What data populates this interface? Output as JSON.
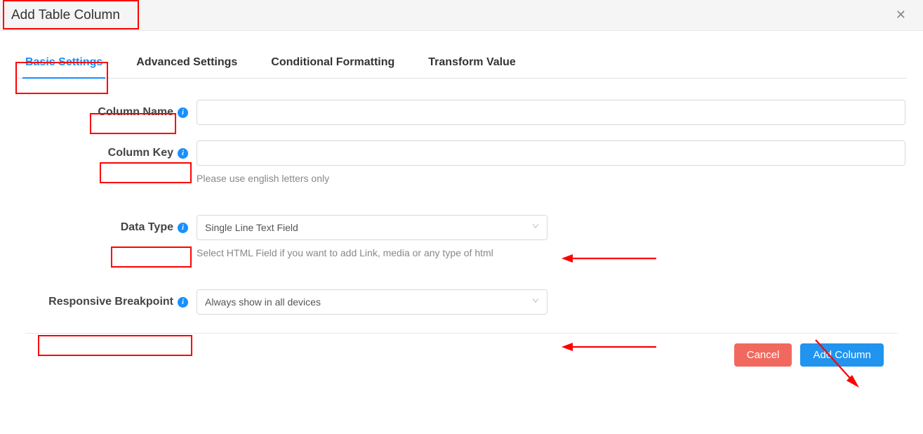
{
  "header": {
    "title": "Add Table Column"
  },
  "tabs": {
    "basic": "Basic Settings",
    "advanced": "Advanced Settings",
    "conditional": "Conditional Formatting",
    "transform": "Transform Value"
  },
  "form": {
    "columnName": {
      "label": "Column Name",
      "value": ""
    },
    "columnKey": {
      "label": "Column Key",
      "value": "",
      "help": "Please use english letters only"
    },
    "dataType": {
      "label": "Data Type",
      "selected": "Single Line Text Field",
      "help": "Select HTML Field if you want to add Link, media or any type of html"
    },
    "responsive": {
      "label": "Responsive Breakpoint",
      "selected": "Always show in all devices"
    }
  },
  "footer": {
    "cancel": "Cancel",
    "submit": "Add Column"
  }
}
